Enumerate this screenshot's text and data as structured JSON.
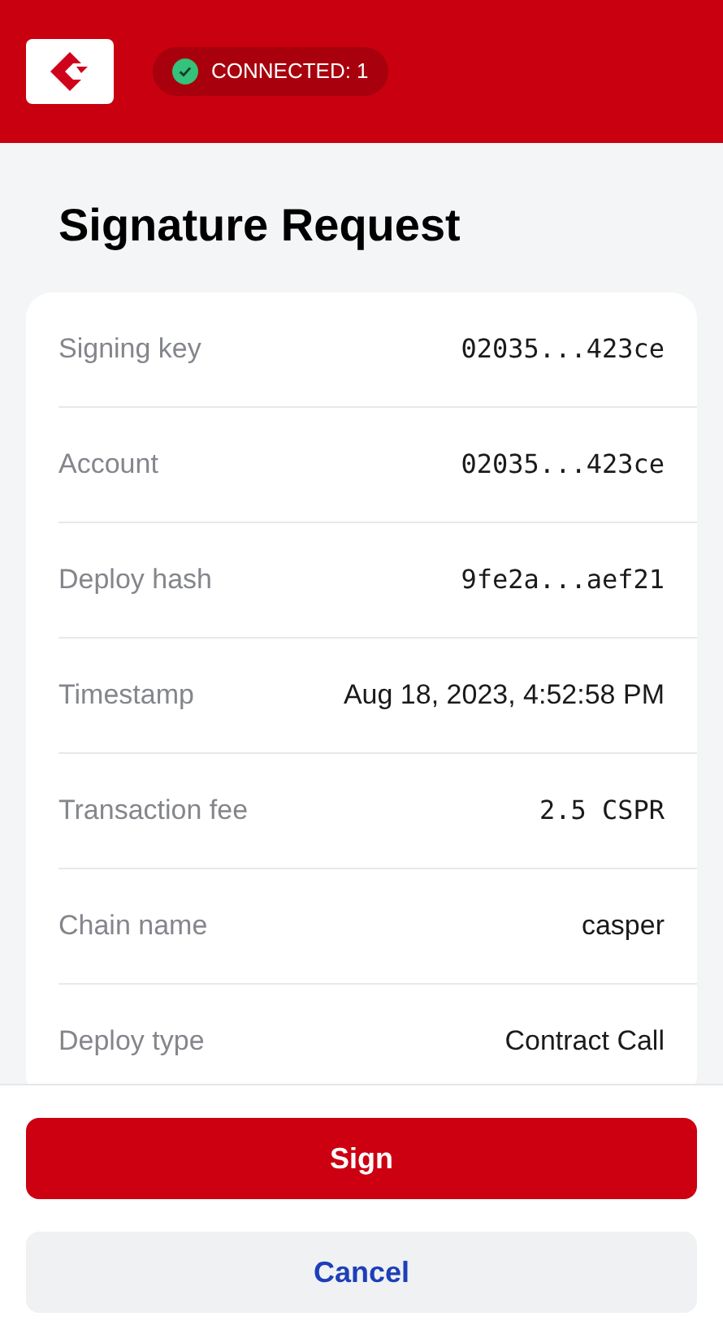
{
  "header": {
    "status": {
      "label": "CONNECTED: 1",
      "connected": true
    }
  },
  "title": "Signature Request",
  "details": [
    {
      "label": "Signing key",
      "value": "02035...423ce",
      "kind": "mono"
    },
    {
      "label": "Account",
      "value": "02035...423ce",
      "kind": "mono"
    },
    {
      "label": "Deploy hash",
      "value": "9fe2a...aef21",
      "kind": "mono"
    },
    {
      "label": "Timestamp",
      "value": "Aug 18, 2023, 4:52:58 PM",
      "kind": "text"
    },
    {
      "label": "Transaction fee",
      "value": "2.5 CSPR",
      "kind": "mono"
    },
    {
      "label": "Chain name",
      "value": "casper",
      "kind": "text"
    },
    {
      "label": "Deploy type",
      "value": "Contract Call",
      "kind": "text"
    }
  ],
  "buttons": [
    {
      "label": "Sign",
      "kind": "primary"
    },
    {
      "label": "Cancel",
      "kind": "secondary"
    }
  ]
}
